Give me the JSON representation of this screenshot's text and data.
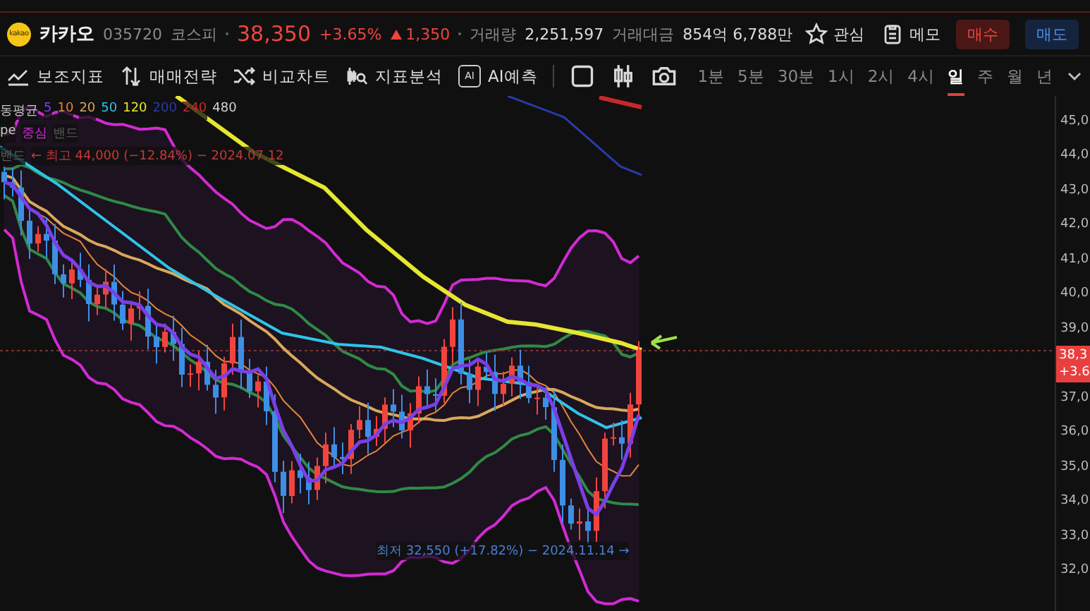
{
  "header": {
    "logo_text": "kakao",
    "name": "카카오",
    "code": "035720",
    "market": "코스피",
    "price": "38,350",
    "change_pct": "+3.65%",
    "change": "1,350",
    "volume_label": "거래량",
    "volume": "2,251,597",
    "amount_label": "거래대금",
    "amount": "854억 6,788만",
    "actions": [
      {
        "kind": "star",
        "label": "관심"
      },
      {
        "kind": "memo",
        "label": "메모"
      }
    ],
    "trade_buttons": [
      {
        "kind": "buy",
        "label": "매수"
      },
      {
        "kind": "sell",
        "label": "매도"
      }
    ]
  },
  "toolbar": {
    "tools": [
      {
        "kind": "indicator",
        "label": "보조지표"
      },
      {
        "kind": "strategy",
        "label": "매매전략"
      },
      {
        "kind": "compare",
        "label": "비교차트"
      },
      {
        "kind": "analysis",
        "label": "지표분석"
      },
      {
        "kind": "ai",
        "label": "AI예측",
        "icon_text": "AI"
      }
    ],
    "icon_buttons": [
      {
        "kind": "square"
      },
      {
        "kind": "candle"
      },
      {
        "kind": "camera"
      }
    ],
    "periods": [
      {
        "label": "1분",
        "selected": false
      },
      {
        "label": "5분",
        "selected": false
      },
      {
        "label": "30분",
        "selected": false
      },
      {
        "label": "1시",
        "selected": false
      },
      {
        "label": "2시",
        "selected": false
      },
      {
        "label": "4시",
        "selected": false
      },
      {
        "label": "일",
        "selected": true
      },
      {
        "label": "주",
        "selected": false
      },
      {
        "label": "월",
        "selected": false
      },
      {
        "label": "년",
        "selected": false
      }
    ]
  },
  "chart": {
    "legend": [
      [
        {
          "text": "동평균",
          "color": "#c8c8c8"
        },
        {
          "text": "5",
          "color": "#7a3fe6"
        },
        {
          "text": "10",
          "color": "#e0863a"
        },
        {
          "text": "20",
          "color": "#d9a85a"
        },
        {
          "text": "50",
          "color": "#2fc4e8"
        },
        {
          "text": "120",
          "color": "#e6e632"
        },
        {
          "text": "200",
          "color": "#2a3aa8"
        },
        {
          "text": "240",
          "color": "#c8282a"
        },
        {
          "text": "480",
          "color": "#d4d4d4"
        }
      ],
      [
        {
          "text": "pe",
          "color": "#c8c8c8"
        },
        {
          "text": "중심",
          "color": "#d22ad2"
        },
        {
          "text": "밴드",
          "color": "#5a5a5a"
        }
      ],
      [
        {
          "text": "밴드",
          "color": "#5a5a5a"
        },
        {
          "text": "← 최고 44,000 (−12.84%) − 2024.07.12",
          "color": "#c03a3a"
        }
      ]
    ],
    "low_note": "최저 32,550 (+17.82%) − 2024.11.14 →",
    "price_axis": {
      "upper": [
        "45,0",
        "44,0",
        "43,0",
        "42,0",
        "41,0",
        "40,0",
        "39,0"
      ],
      "lower": [
        "37,0",
        "36,0",
        "35,0",
        "34,0",
        "33,0",
        "32,0"
      ]
    },
    "price_tag": {
      "price": "38,3",
      "change": "+3.6"
    }
  }
}
